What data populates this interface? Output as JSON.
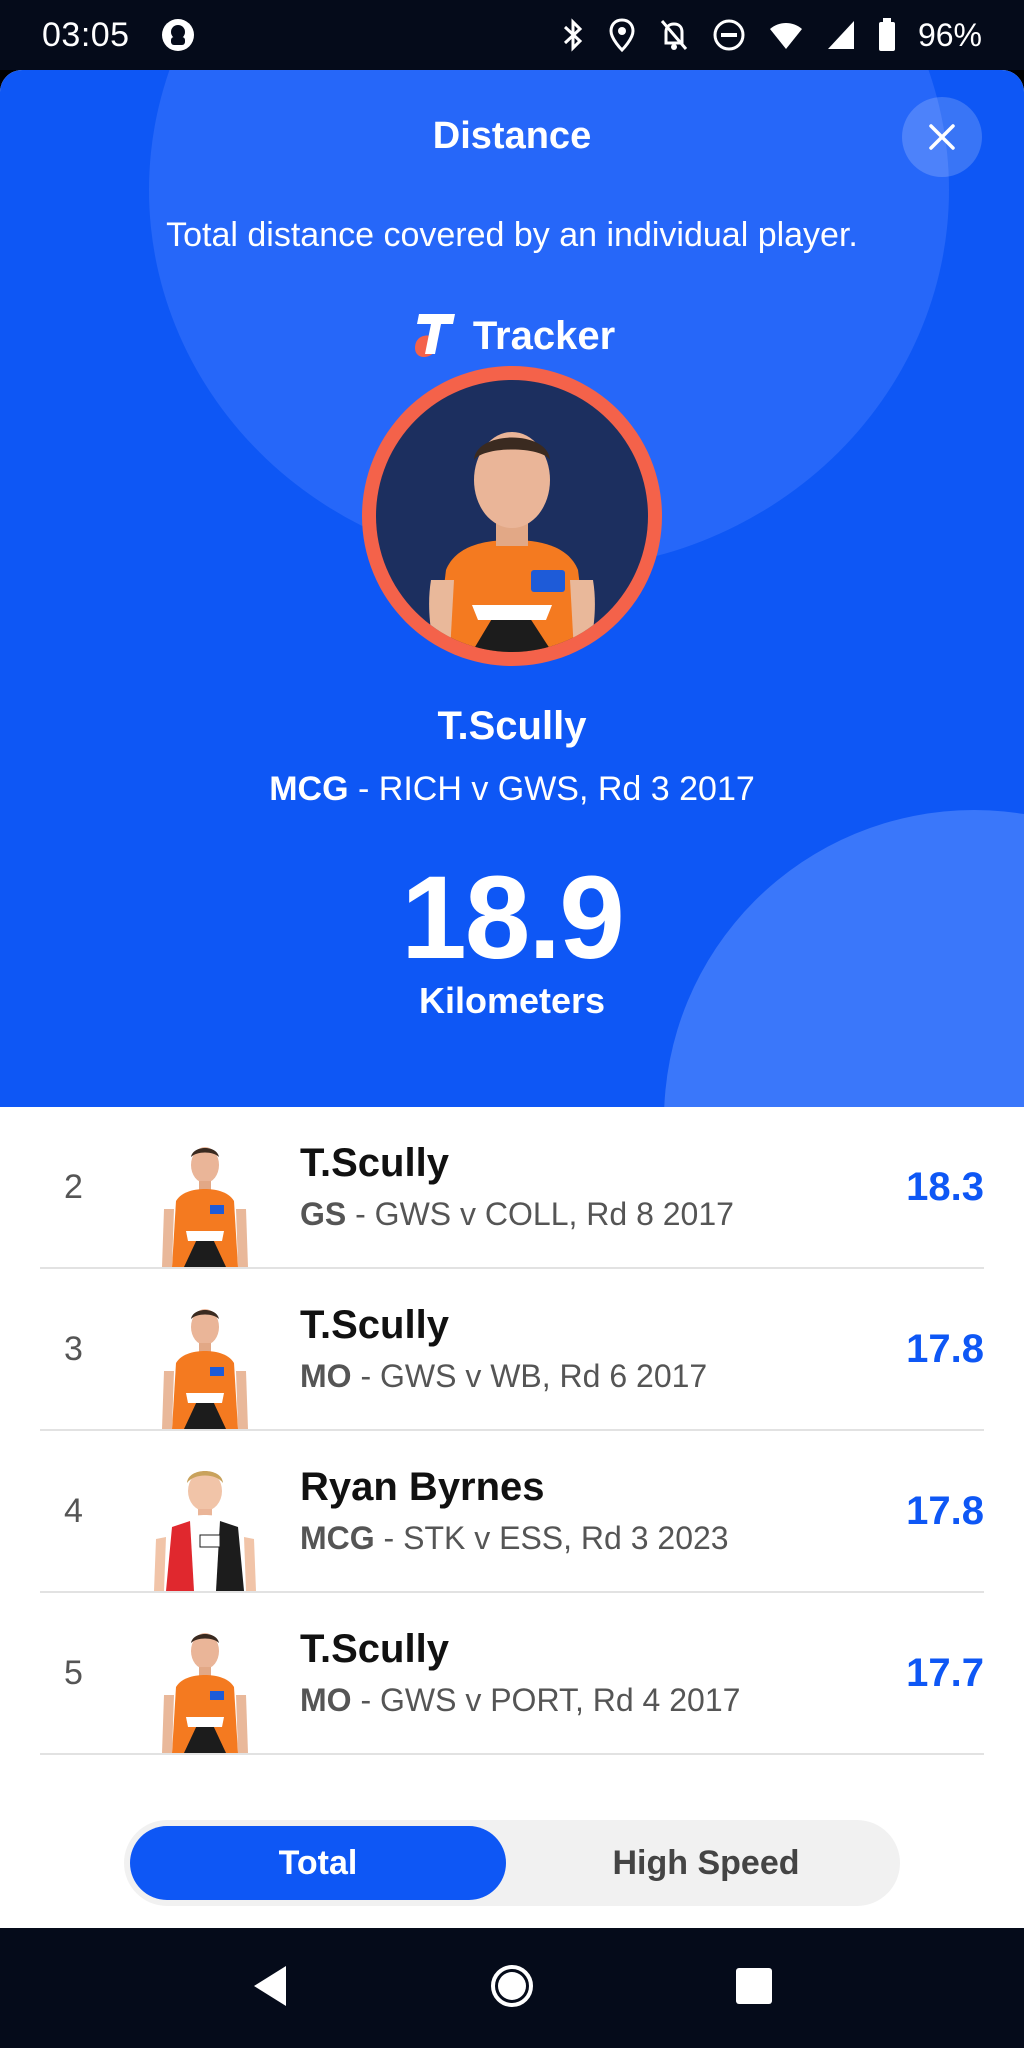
{
  "status_bar": {
    "time": "03:05",
    "battery": "96%"
  },
  "header": {
    "title": "Distance",
    "description": "Total distance covered by an individual player.",
    "tracker_label": "Tracker"
  },
  "leader": {
    "name": "T.Scully",
    "venue": "MCG",
    "match": " - RICH v GWS, Rd 3 2017",
    "value": "18.9",
    "unit": "Kilometers"
  },
  "rankings": [
    {
      "rank": "2",
      "name": "T.Scully",
      "venue": "GS",
      "match": " - GWS v COLL, Rd 8 2017",
      "value": "18.3"
    },
    {
      "rank": "3",
      "name": "T.Scully",
      "venue": "MO",
      "match": " - GWS v WB, Rd 6 2017",
      "value": "17.8"
    },
    {
      "rank": "4",
      "name": "Ryan Byrnes",
      "venue": "MCG",
      "match": " - STK v ESS, Rd 3 2023",
      "value": "17.8"
    },
    {
      "rank": "5",
      "name": "T.Scully",
      "venue": "MO",
      "match": " - GWS v PORT, Rd 4 2017",
      "value": "17.7"
    }
  ],
  "toggle": {
    "total_label": "Total",
    "high_speed_label": "High Speed",
    "selected": "Total"
  },
  "colors": {
    "brand_blue": "#0e57f5",
    "tracker_orange": "#f4624a",
    "gws_orange": "#f47a20"
  }
}
